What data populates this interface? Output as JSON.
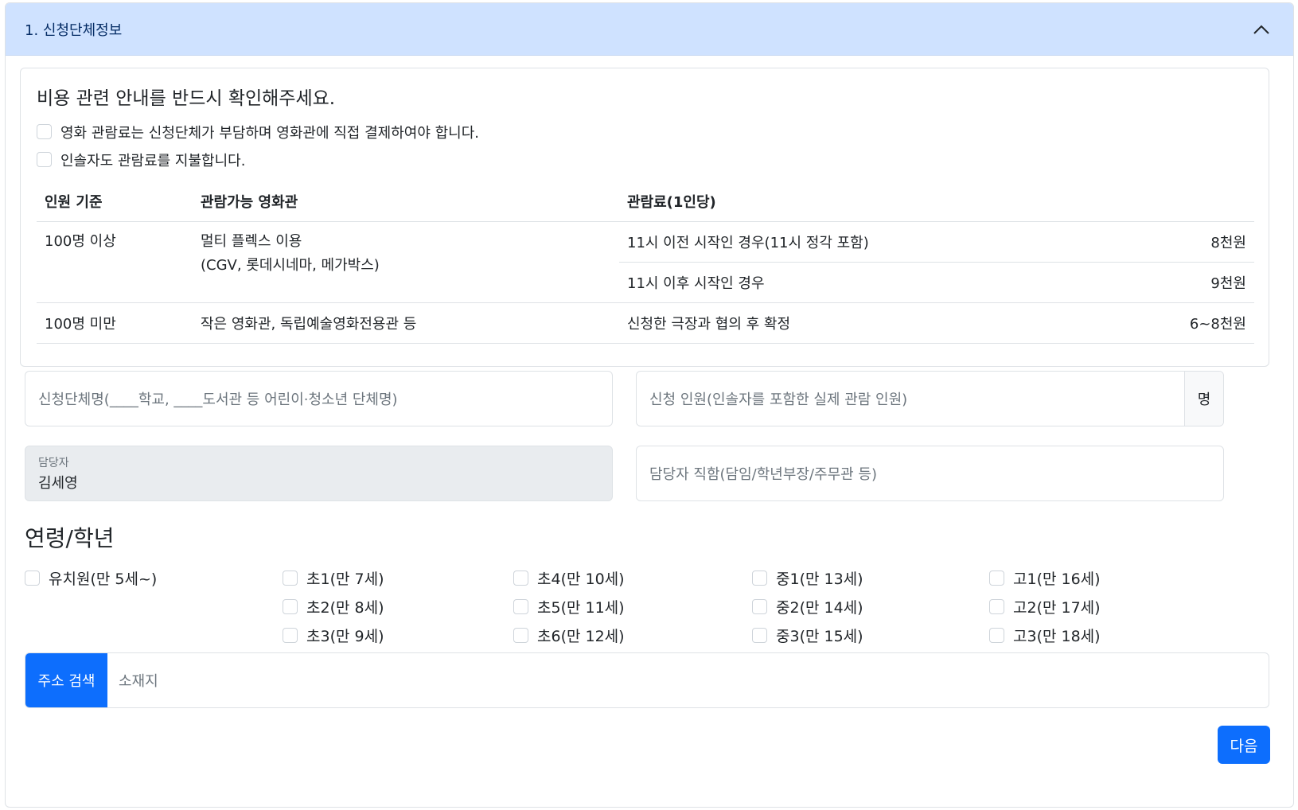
{
  "section": {
    "title": "1. 신청단체정보"
  },
  "notice": {
    "title": "비용 관련 안내를 반드시 확인해주세요.",
    "checks": [
      "영화 관람료는 신청단체가 부담하며 영화관에 직접 결제하여야 합니다.",
      "인솔자도 관람료를 지불합니다."
    ],
    "table": {
      "headers": [
        "인원 기준",
        "관람가능 영화관",
        "관람료(1인당)"
      ],
      "rows": [
        {
          "group": "100명 이상",
          "theater_line1": "멀티 플렉스 이용",
          "theater_line2": "(CGV, 롯데시네마, 메가박스)",
          "fees": [
            {
              "condition": "11시 이전 시작인 경우(11시 정각 포함)",
              "price": "8천원"
            },
            {
              "condition": "11시 이후 시작인 경우",
              "price": "9천원"
            }
          ]
        },
        {
          "group": "100명 미만",
          "theater_line1": "작은 영화관, 독립예술영화전용관 등",
          "fees": [
            {
              "condition": "신청한 극장과 협의 후 확정",
              "price": "6~8천원"
            }
          ]
        }
      ]
    }
  },
  "form": {
    "org_name_placeholder": "신청단체명(____학교, ____도서관 등 어린이·청소년 단체명)",
    "headcount_placeholder": "신청 인원(인솔자를 포함한 실제 관람 인원)",
    "headcount_unit": "명",
    "manager_label": "담당자",
    "manager_value": "김세영",
    "position_placeholder": "담당자 직함(담임/학년부장/주무관 등)"
  },
  "age": {
    "title": "연령/학년",
    "options": [
      "유치원(만 5세~)",
      "초1(만 7세)",
      "초2(만 8세)",
      "초3(만 9세)",
      "초4(만 10세)",
      "초5(만 11세)",
      "초6(만 12세)",
      "중1(만 13세)",
      "중2(만 14세)",
      "중3(만 15세)",
      "고1(만 16세)",
      "고2(만 17세)",
      "고3(만 18세)"
    ]
  },
  "address": {
    "button_label": "주소 검색",
    "placeholder": "소재지"
  },
  "next_label": "다음"
}
